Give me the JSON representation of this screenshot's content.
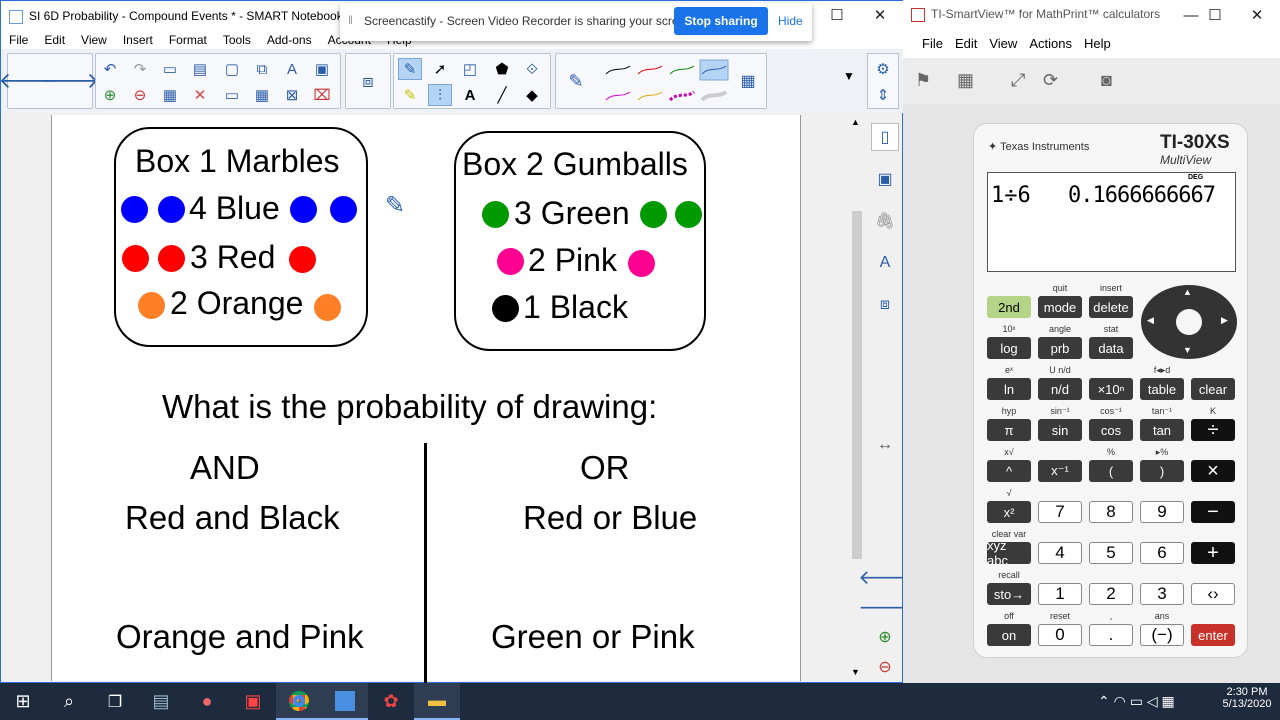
{
  "smart": {
    "title": "SI 6D Probability - Compound Events * - SMART Notebook",
    "menu": [
      "File",
      "Edit",
      "View",
      "Insert",
      "Format",
      "Tools",
      "Add-ons",
      "Account",
      "Help"
    ]
  },
  "screencastify": {
    "message": "Screencastify - Screen Video Recorder is sharing your screen.",
    "stop_label": "Stop sharing",
    "hide_label": "Hide"
  },
  "page": {
    "box1": {
      "title": "Box 1 Marbles",
      "l1": "4 Blue",
      "l2": "3 Red",
      "l3": "2 Orange"
    },
    "box2": {
      "title": "Box 2 Gumballs",
      "l1": "3 Green",
      "l2": "2 Pink",
      "l3": "1 Black"
    },
    "question": "What is the probability of drawing:",
    "and_header": "AND",
    "or_header": "OR",
    "and1": "Red and Black",
    "or1": "Red or Blue",
    "and2": "Orange and Pink",
    "or2": "Green or Pink"
  },
  "colors": {
    "blue": "#0000ff",
    "red": "#ff0000",
    "orange": "#ff7f27",
    "green": "#009900",
    "pink": "#ff0090",
    "black": "#000000"
  },
  "ti": {
    "title": "TI-SmartView™ for MathPrint™ calculators",
    "menu": [
      "File",
      "Edit",
      "View",
      "Actions",
      "Help"
    ],
    "brand": "Texas Instruments",
    "model": "TI-30XS",
    "model_sub": "MultiView",
    "deg": "DEG",
    "entry": "1÷6",
    "result": "0.1666666667",
    "rows": [
      [
        {
          "t": "2nd",
          "s": "",
          "c": "kg"
        },
        {
          "t": "mode",
          "s": "quit",
          "c": "kd"
        },
        {
          "t": "delete",
          "s": "insert",
          "c": "kd"
        }
      ],
      [
        {
          "t": "log",
          "s": "10ˣ",
          "c": "kd"
        },
        {
          "t": "prb",
          "s": "angle",
          "c": "kd"
        },
        {
          "t": "data",
          "s": "stat",
          "c": "kd"
        }
      ],
      [
        {
          "t": "ln",
          "s": "eˣ",
          "c": "kd"
        },
        {
          "t": "n/d",
          "s": "U n/d",
          "c": "kd"
        },
        {
          "t": "×10ⁿ",
          "s": "",
          "c": "kd"
        },
        {
          "t": "table",
          "s": "f◂▸d",
          "c": "kd"
        },
        {
          "t": "clear",
          "s": "",
          "c": "kd"
        }
      ],
      [
        {
          "t": "π",
          "s": "hyp",
          "c": "kd"
        },
        {
          "t": "sin",
          "s": "sin⁻¹",
          "c": "kd"
        },
        {
          "t": "cos",
          "s": "cos⁻¹",
          "c": "kd"
        },
        {
          "t": "tan",
          "s": "tan⁻¹",
          "c": "kd"
        },
        {
          "t": "÷",
          "s": "K",
          "c": "kk"
        }
      ],
      [
        {
          "t": "^",
          "s": "x√",
          "c": "kd"
        },
        {
          "t": "x⁻¹",
          "s": "",
          "c": "kd"
        },
        {
          "t": "(",
          "s": "%",
          "c": "kd"
        },
        {
          "t": ")",
          "s": "▸%",
          "c": "kd"
        },
        {
          "t": "×",
          "s": "",
          "c": "kk"
        }
      ],
      [
        {
          "t": "x²",
          "s": "√",
          "c": "kd"
        },
        {
          "t": "7",
          "s": "",
          "c": "kw"
        },
        {
          "t": "8",
          "s": "",
          "c": "kw"
        },
        {
          "t": "9",
          "s": "",
          "c": "kw"
        },
        {
          "t": "−",
          "s": "",
          "c": "kk"
        }
      ],
      [
        {
          "t": "xyz abc",
          "s": "clear var",
          "c": "kd"
        },
        {
          "t": "4",
          "s": "",
          "c": "kw"
        },
        {
          "t": "5",
          "s": "",
          "c": "kw"
        },
        {
          "t": "6",
          "s": "",
          "c": "kw"
        },
        {
          "t": "+",
          "s": "",
          "c": "kk"
        }
      ],
      [
        {
          "t": "sto→",
          "s": "recall",
          "c": "kd"
        },
        {
          "t": "1",
          "s": "",
          "c": "kw"
        },
        {
          "t": "2",
          "s": "",
          "c": "kw"
        },
        {
          "t": "3",
          "s": "",
          "c": "kw"
        },
        {
          "t": "‹›",
          "s": "",
          "c": "kw"
        }
      ],
      [
        {
          "t": "on",
          "s": "off",
          "c": "kd"
        },
        {
          "t": "0",
          "s": "reset",
          "c": "kw"
        },
        {
          "t": ".",
          "s": ",",
          "c": "kw"
        },
        {
          "t": "(−)",
          "s": "ans",
          "c": "kw"
        },
        {
          "t": "enter",
          "s": "",
          "c": "kr"
        }
      ]
    ]
  },
  "taskbar": {
    "time": "2:30 PM",
    "date": "5/13/2020"
  }
}
